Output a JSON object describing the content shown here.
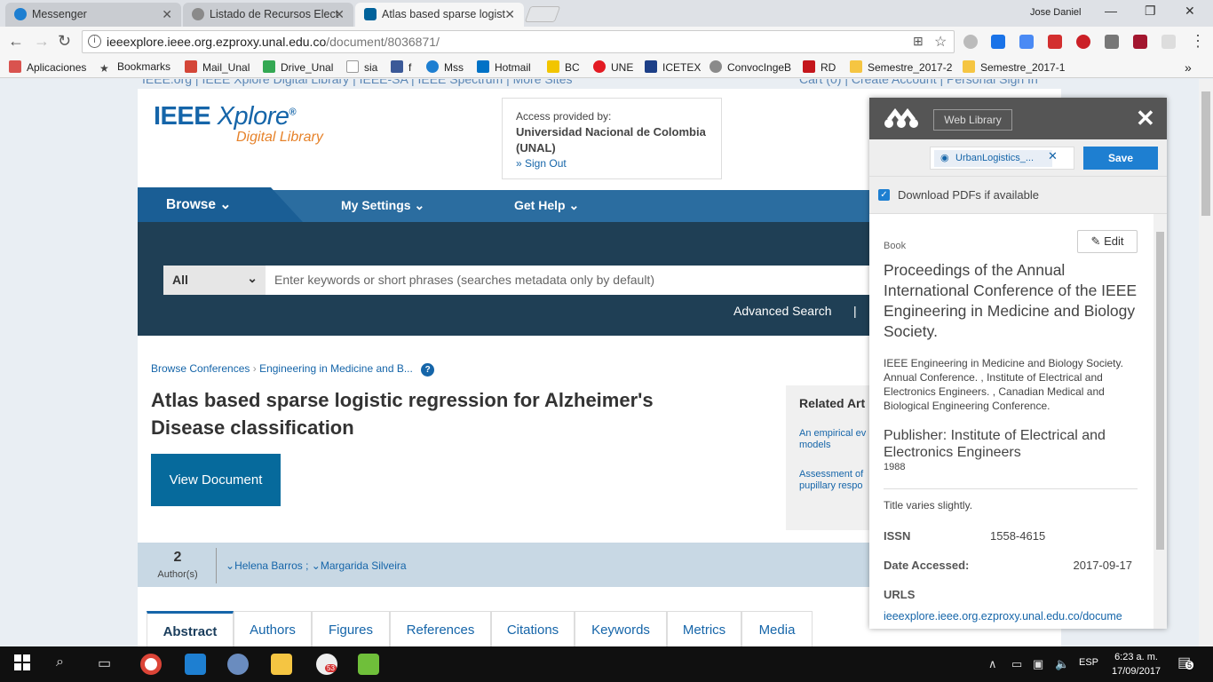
{
  "browser": {
    "tabs": [
      {
        "label": "Messenger",
        "active": false,
        "icon": "messenger-icon",
        "color": "#1e7fd1"
      },
      {
        "label": "Listado de Recursos Elect",
        "active": false,
        "icon": "unal-seal-icon",
        "color": "#8a8a8a"
      },
      {
        "label": "Atlas based sparse logist",
        "active": true,
        "icon": "ieee-icon",
        "color": "#00629b"
      }
    ],
    "user": "Jose Daniel",
    "url_host": "ieeexplore.ieee.org.ezproxy.unal.edu.co",
    "url_path": "/document/8036871/",
    "bookmarks": [
      {
        "label": "Aplicaciones",
        "icon": "apps-grid-icon",
        "color": "#d9534f"
      },
      {
        "label": "Bookmarks",
        "icon": "star-icon",
        "color": "#444444"
      },
      {
        "label": "Mail_Unal",
        "icon": "gmail-icon",
        "color": "#d44638"
      },
      {
        "label": "Drive_Unal",
        "icon": "drive-icon",
        "color": "#34a853"
      },
      {
        "label": "sia",
        "icon": "page-icon",
        "color": "#bbbbbb"
      },
      {
        "label": "f",
        "icon": "facebook-icon",
        "color": "#3b5998"
      },
      {
        "label": "Mss",
        "icon": "messenger-icon",
        "color": "#1e7fd1"
      },
      {
        "label": "Hotmail",
        "icon": "outlook-icon",
        "color": "#0072c6"
      },
      {
        "label": "BC",
        "icon": "bancolombia-icon",
        "color": "#f2c500"
      },
      {
        "label": "UNE",
        "icon": "une-icon",
        "color": "#e31b23"
      },
      {
        "label": "ICETEX",
        "icon": "icetex-icon",
        "color": "#1d3f87"
      },
      {
        "label": "ConvocIngeB",
        "icon": "unal-seal-icon",
        "color": "#8a8a8a"
      },
      {
        "label": "RD",
        "icon": "rd-icon",
        "color": "#c4161c"
      },
      {
        "label": "Semestre_2017-2",
        "icon": "folder-icon",
        "color": "#f5c542"
      },
      {
        "label": "Semestre_2017-1",
        "icon": "folder-icon",
        "color": "#f5c542"
      }
    ]
  },
  "ieee": {
    "top_links_left": "IEEE.org | IEEE Xplore Digital Library | IEEE-SA | IEEE Spectrum | More Sites",
    "top_links_right": "Cart (0) | Create Account | Personal Sign In",
    "logo_main": "IEEE",
    "logo_italic": "Xplore",
    "logo_sub": "Digital Library",
    "access_label": "Access provided by:",
    "access_org": "Universidad Nacional de Colombia (UNAL)",
    "sign_out": "Sign Out",
    "nav": [
      "Browse",
      "My Settings",
      "Get Help"
    ],
    "search_scope": "All",
    "search_placeholder": "Enter keywords or short phrases (searches metadata only by default)",
    "advanced_search": "Advanced Search",
    "breadcrumb": [
      "Browse Conferences",
      "Engineering in Medicine and B..."
    ],
    "doc_title": "Atlas based sparse logistic regression for Alzheimer's Disease classification",
    "view_document": "View Document",
    "related_title": "Related Art",
    "related_items": [
      "An empirical ev",
      "models",
      "Assessment of",
      "pupillary respo"
    ],
    "author_count": "2",
    "author_count_label": "Author(s)",
    "authors": [
      "Helena Barros",
      "Margarida Silveira"
    ],
    "tabs": [
      "Abstract",
      "Authors",
      "Figures",
      "References",
      "Citations",
      "Keywords",
      "Metrics",
      "Media"
    ]
  },
  "mendeley": {
    "web_library": "Web Library",
    "folder": "UrbanLogistics_...",
    "save": "Save",
    "download_pdfs": "Download PDFs if available",
    "type": "Book",
    "edit": "Edit",
    "title": "Proceedings of the Annual International Conference of the IEEE Engineering in Medicine and Biology Society.",
    "authors": "IEEE Engineering in Medicine and Biology Society. Annual Conference. , Institute of Electrical and Electronics Engineers. , Canadian Medical and Biological Engineering Conference.",
    "publisher": "Publisher: Institute of Electrical and Electronics Engineers",
    "year": "1988",
    "note": "Title varies slightly.",
    "issn_label": "ISSN",
    "issn": "1558-4615",
    "accessed_label": "Date Accessed:",
    "accessed": "2017-09-17",
    "urls_label": "URLS",
    "url": "ieeexplore.ieee.org.ezproxy.unal.edu.co/docume"
  },
  "taskbar": {
    "time": "6:23 a. m.",
    "date": "17/09/2017",
    "lang": "ESP",
    "badge": "53",
    "notifications": "5"
  }
}
